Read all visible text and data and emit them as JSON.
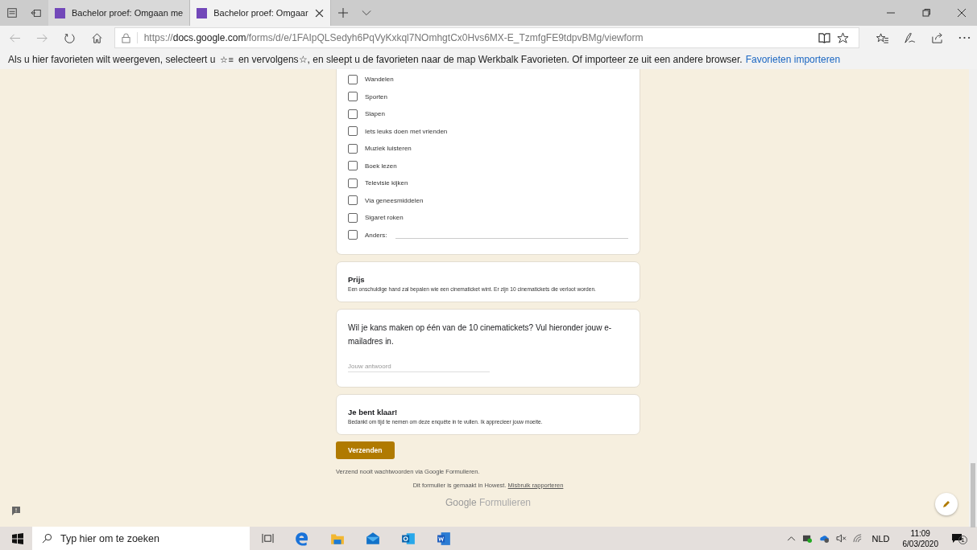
{
  "browser": {
    "tabs": [
      {
        "title": "Bachelor proef: Omgaan me",
        "selected": false
      },
      {
        "title": "Bachelor proef: Omgaar",
        "selected": true
      }
    ],
    "url": {
      "prefix": "https://",
      "host": "docs.google.com",
      "path": "/forms/d/e/1FAIpQLSedyh6PqVyKxkql7NOmhgtCx0Hvs6MX-E_TzmfgFE9tdpvBMg/viewform"
    },
    "favorites_bar": {
      "text_before": "Als u hier favorieten wilt weergeven, selecteert u",
      "star_list": "☆≡",
      "text_after": "en vervolgens☆, en sleept u de favorieten naar de map Werkbalk Favorieten. Of importeer ze uit een andere browser.",
      "link": "Favorieten importeren"
    }
  },
  "form": {
    "options": [
      {
        "kind": "option",
        "label": "Wandelen",
        "checked": false
      },
      {
        "kind": "option",
        "label": "Sporten",
        "checked": false
      },
      {
        "kind": "option",
        "label": "Slapen",
        "checked": false
      },
      {
        "kind": "option",
        "label": "Iets leuks doen met vrienden",
        "checked": false
      },
      {
        "kind": "option",
        "label": "Muziek luisteren",
        "checked": false
      },
      {
        "kind": "option",
        "label": "Boek lezen",
        "checked": false
      },
      {
        "kind": "option",
        "label": "Televisie kijken",
        "checked": false
      },
      {
        "kind": "option",
        "label": "Via geneesmiddelen",
        "checked": false
      },
      {
        "kind": "option",
        "label": "Sigaret roken",
        "checked": false
      },
      {
        "kind": "other",
        "label": "Anders:",
        "checked": false
      }
    ],
    "prize": {
      "title": "Prijs",
      "description": "Een onschuldige hand zal bepalen wie een cinematicket wint. Er zijn 10 cinematickets die verloot worden."
    },
    "question": {
      "text": "Wil je kans maken op één van de 10 cinematickets? Vul hieronder jouw e-mailadres in.",
      "placeholder": "Jouw antwoord"
    },
    "done": {
      "title": "Je bent klaar!",
      "description": "Bedankt om tijd te nemen om deze enquête in te vullen. Ik apprecieer jouw moeite."
    },
    "submit": "Verzenden",
    "warning": "Verzend nooit wachtwoorden via Google Formulieren.",
    "made_in": "Dit formulier is gemaakt in Howest.",
    "abuse_link": "Misbruik rapporteren",
    "logo": {
      "google": "Google",
      "product": "Formulieren"
    }
  },
  "taskbar": {
    "search_placeholder": "Typ hier om te zoeken",
    "language": "NLD",
    "time": "11:09",
    "date": "6/03/2020",
    "notifications": "1"
  }
}
